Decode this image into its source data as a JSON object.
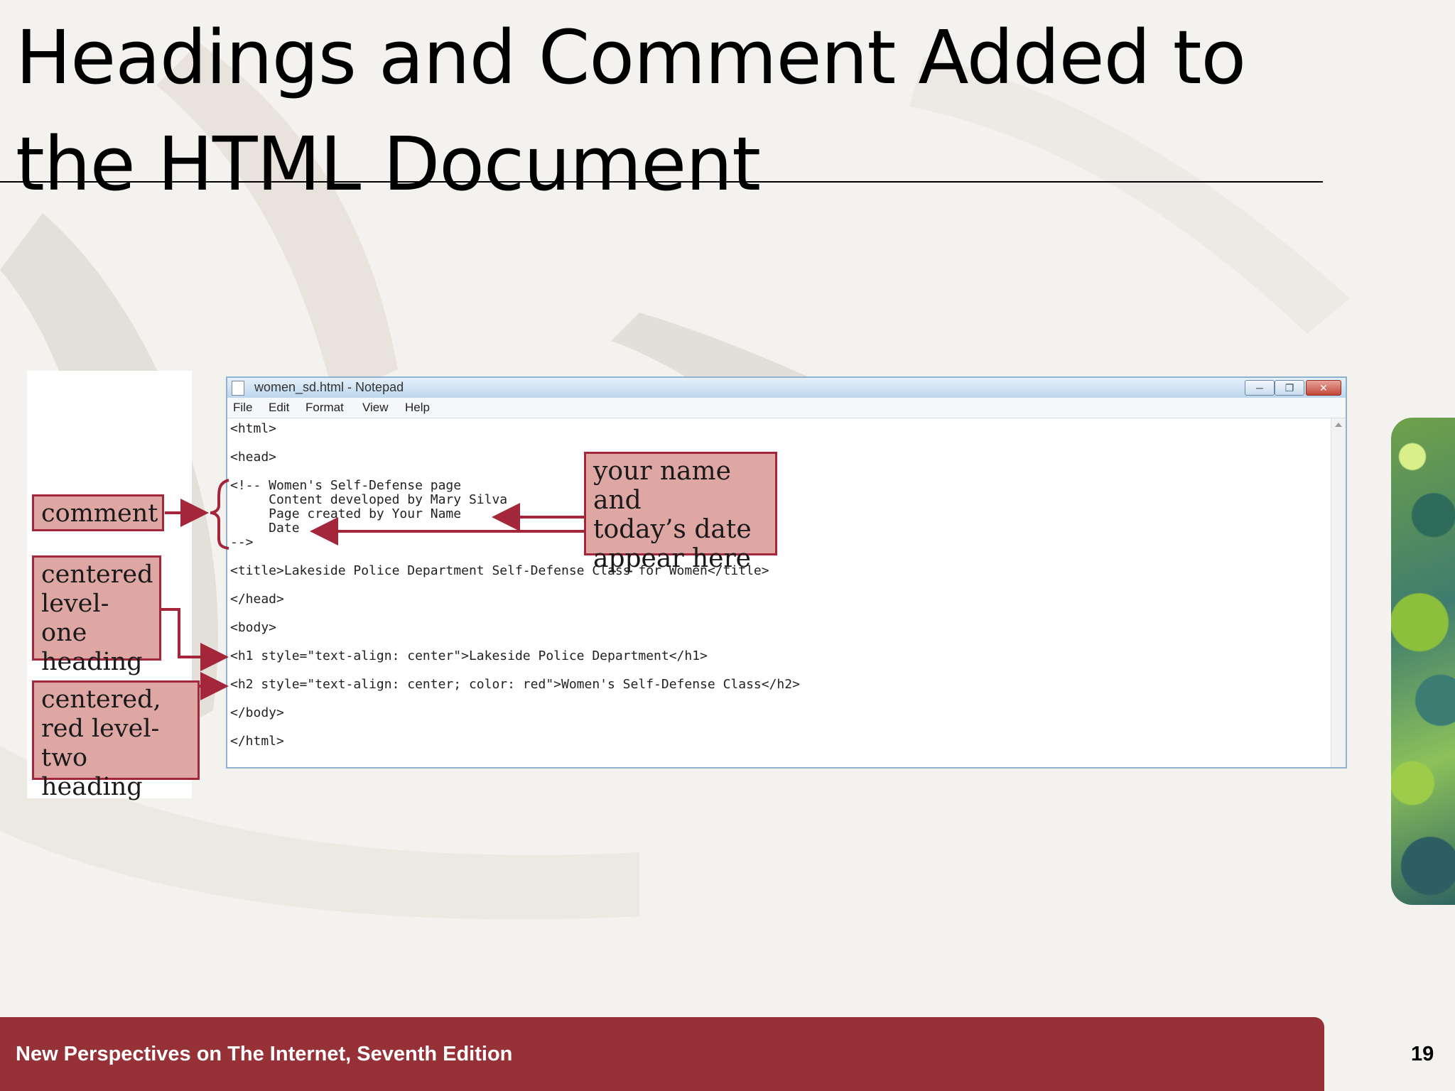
{
  "slide": {
    "title_line1": "Headings and Comment Added to",
    "title_line2": "the HTML Document",
    "page_number": "19",
    "footer": "New Perspectives on The Internet, Seventh Edition"
  },
  "notepad": {
    "window_title": "women_sd.html - Notepad",
    "menu": [
      "File",
      "Edit",
      "Format",
      "View",
      "Help"
    ],
    "code_lines": [
      "<html>",
      "<head>",
      "<!-- Women's Self-Defense page",
      "     Content developed by Mary Silva",
      "     Page created by Your Name",
      "     Date",
      "-->",
      "<title>Lakeside Police Department Self-Defense Class for Women</title>",
      "</head>",
      "<body>",
      "<h1 style=\"text-align: center\">Lakeside Police Department</h1>",
      "<h2 style=\"text-align: center; color: red\">Women's Self-Defense Class</h2>",
      "</body>",
      "</html>"
    ]
  },
  "callouts": {
    "comment": "comment",
    "level_one": [
      "centered",
      "level-one",
      "heading"
    ],
    "level_two": [
      "centered,",
      "red level-",
      "two heading"
    ],
    "name_date": [
      "your name and",
      "today’s date",
      "appear here"
    ]
  },
  "colors": {
    "callout_fill": "#dea7a3",
    "callout_border": "#a3263b",
    "footer_bar": "#963237"
  }
}
